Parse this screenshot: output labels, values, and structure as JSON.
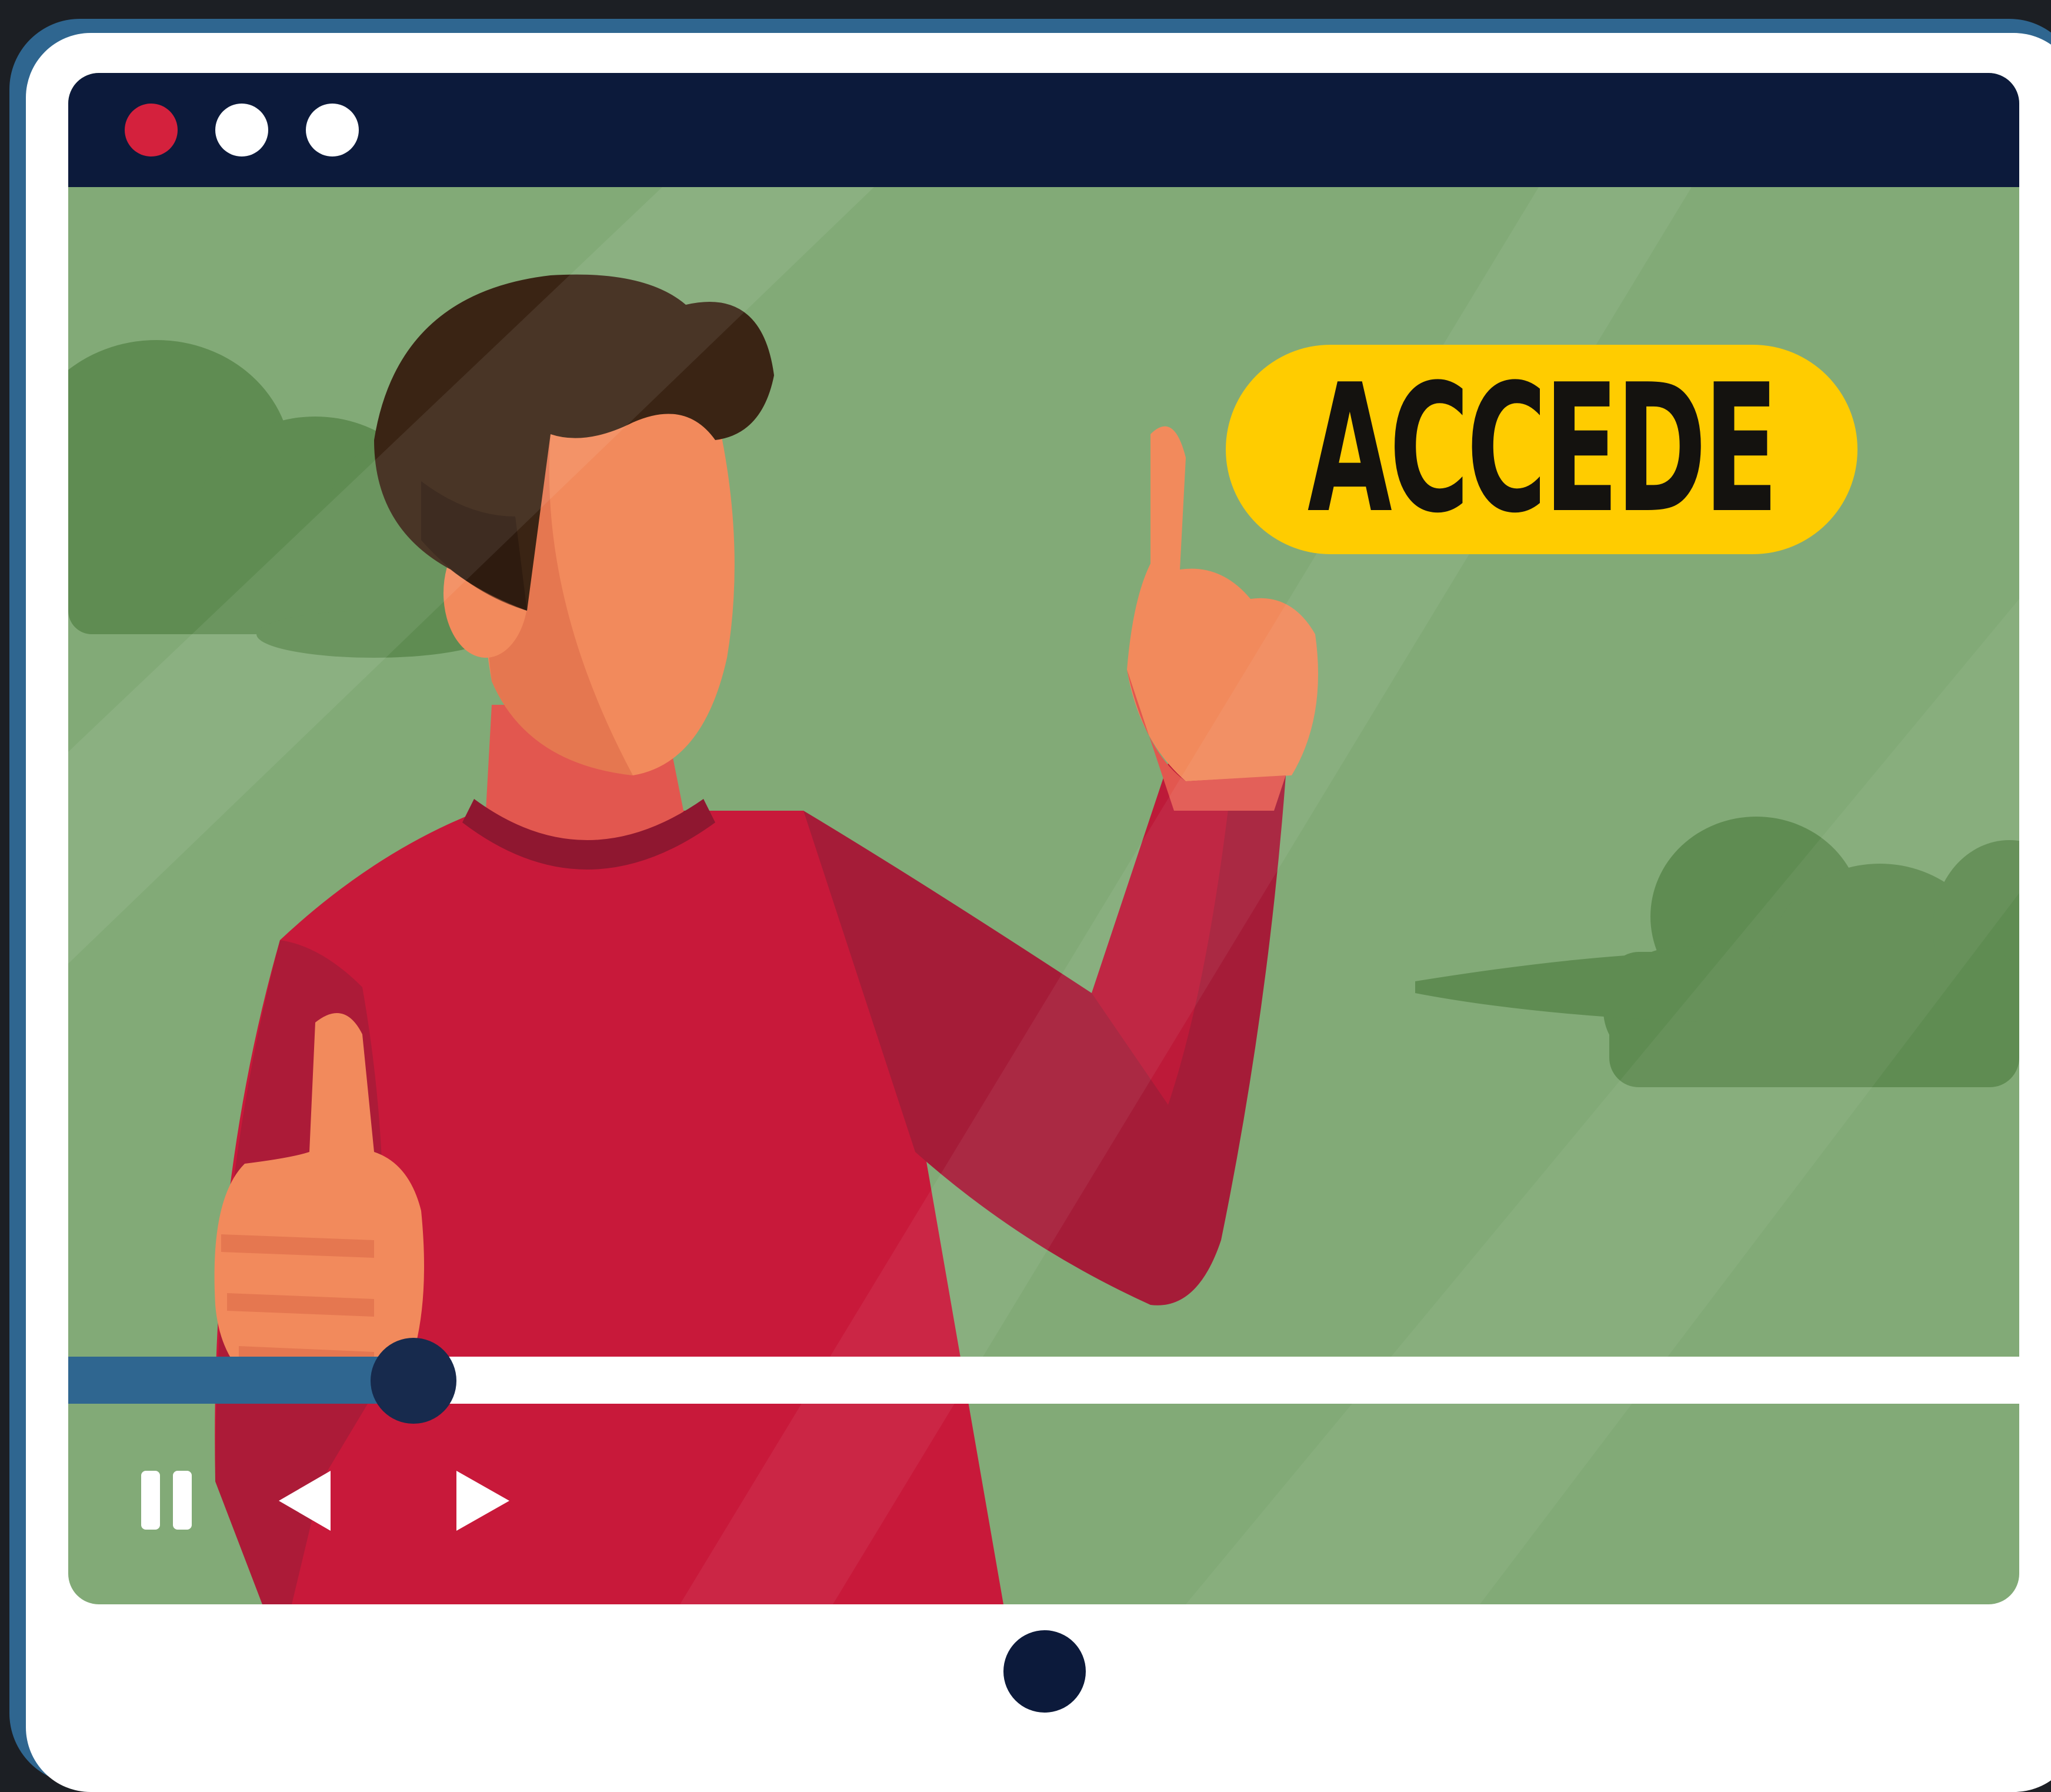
{
  "window": {
    "traffic_lights": {
      "close_color": "#d4213d",
      "minimize_color": "#ffffff",
      "maximize_color": "#ffffff"
    }
  },
  "video": {
    "cta_label": "ACCEDE",
    "playback_progress": 0.177
  },
  "controls": {
    "pause_icon": "pause-icon",
    "previous_icon": "previous-icon",
    "next_icon": "next-icon"
  },
  "colors": {
    "frame": "#ffffff",
    "frame_shadow": "#2f6690",
    "titlebar": "#0c1a3b",
    "background_green": "#82aa77",
    "bush_green": "#5f8c52",
    "sweater_red": "#c8193a",
    "skin": "#f28a5c",
    "hair": "#3a2414",
    "cta_yellow": "#ffcc00",
    "progress_fill": "#2f6690",
    "progress_thumb": "#172a4d"
  }
}
